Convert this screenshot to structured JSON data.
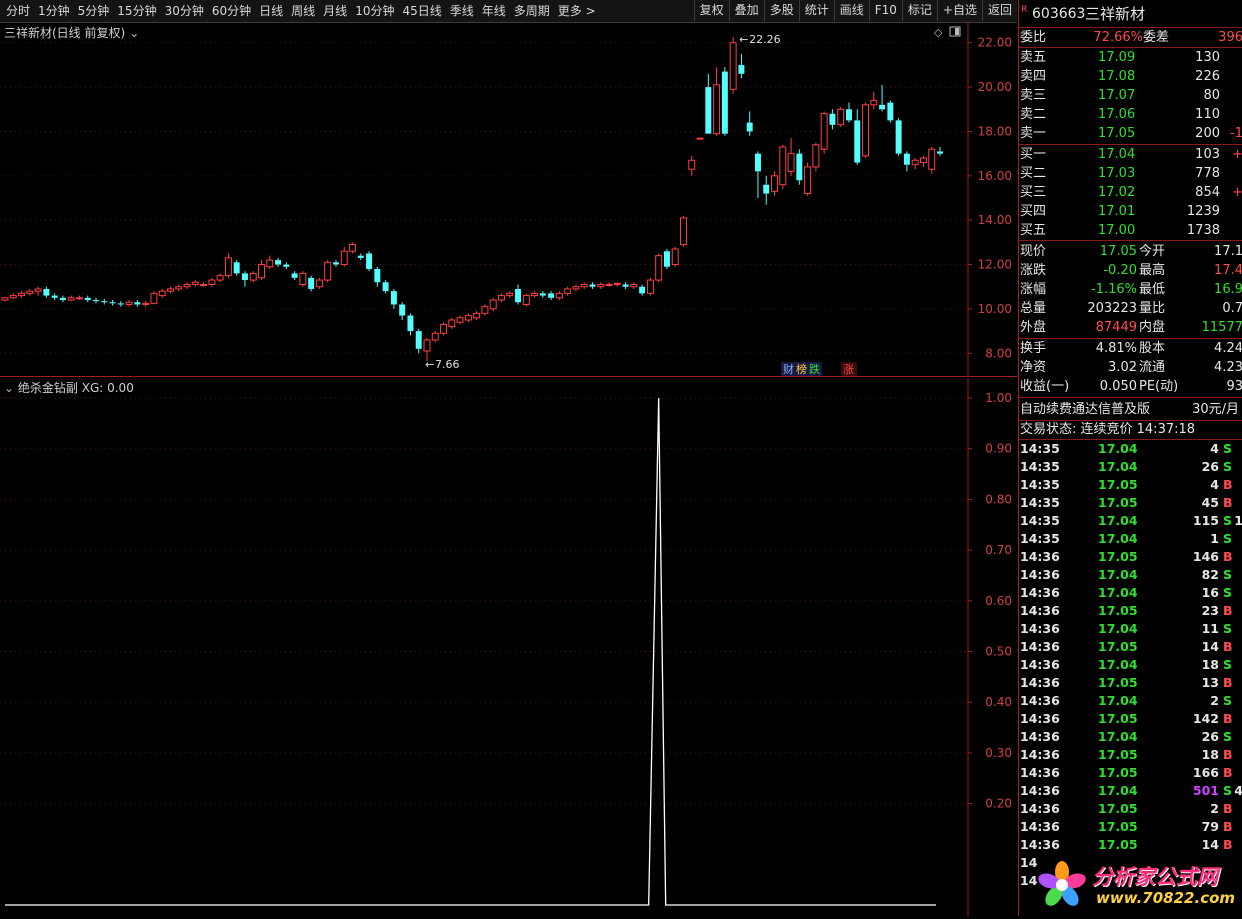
{
  "toolbar": {
    "periods": [
      "分时",
      "1分钟",
      "5分钟",
      "15分钟",
      "30分钟",
      "60分钟",
      "日线",
      "周线",
      "月线",
      "10分钟",
      "45日线",
      "季线",
      "年线",
      "多周期",
      "更多 >"
    ],
    "tools": [
      "复权",
      "叠加",
      "多股",
      "统计",
      "画线",
      "F10",
      "标记",
      "+自选",
      "返回"
    ]
  },
  "main_chart": {
    "title": "三祥新材(日线 前复权)",
    "high_label": "22.26",
    "low_label": "7.66",
    "badge_cai": "财",
    "badge_bang": "榜",
    "badge_die": "跌",
    "badge_zhang": "涨",
    "y_ticks": [
      "22.00",
      "20.00",
      "18.00",
      "16.00",
      "14.00",
      "12.00",
      "10.00",
      "8.00"
    ]
  },
  "indicator": {
    "title": "绝杀金钻副",
    "xg_label": "XG: 0.00",
    "y_ticks": [
      "1.00",
      "0.90",
      "0.80",
      "0.70",
      "0.60",
      "0.50",
      "0.40",
      "0.30",
      "0.20"
    ]
  },
  "chart_data": [
    {
      "type": "candlestick",
      "title": "三祥新材(日线 前复权)",
      "ylim": [
        7.2,
        22.8
      ],
      "grid": true,
      "up_color": "#ff4040",
      "down_color": "#54ffff",
      "candles": [
        [
          10.4,
          10.5,
          10.35,
          10.55
        ],
        [
          10.5,
          10.6,
          10.45,
          10.7
        ],
        [
          10.6,
          10.7,
          10.5,
          10.8
        ],
        [
          10.7,
          10.8,
          10.6,
          10.9
        ],
        [
          10.8,
          10.9,
          10.6,
          11.0
        ],
        [
          10.9,
          10.6,
          10.5,
          11.0
        ],
        [
          10.6,
          10.5,
          10.4,
          10.7
        ],
        [
          10.5,
          10.4,
          10.3,
          10.6
        ],
        [
          10.4,
          10.5,
          10.35,
          10.6
        ],
        [
          10.5,
          10.5,
          10.4,
          10.6
        ],
        [
          10.5,
          10.4,
          10.3,
          10.6
        ],
        [
          10.4,
          10.35,
          10.25,
          10.5
        ],
        [
          10.35,
          10.3,
          10.2,
          10.45
        ],
        [
          10.3,
          10.25,
          10.15,
          10.4
        ],
        [
          10.25,
          10.2,
          10.1,
          10.35
        ],
        [
          10.2,
          10.3,
          10.1,
          10.4
        ],
        [
          10.3,
          10.2,
          10.1,
          10.4
        ],
        [
          10.2,
          10.25,
          10.1,
          10.35
        ],
        [
          10.25,
          10.7,
          10.2,
          10.8
        ],
        [
          10.6,
          10.8,
          10.5,
          10.9
        ],
        [
          10.8,
          10.9,
          10.7,
          11.0
        ],
        [
          10.9,
          11.0,
          10.8,
          11.1
        ],
        [
          11.0,
          11.1,
          10.9,
          11.2
        ],
        [
          11.1,
          11.2,
          11.0,
          11.3
        ],
        [
          11.1,
          11.1,
          11.0,
          11.2
        ],
        [
          11.1,
          11.3,
          11.0,
          11.4
        ],
        [
          11.3,
          11.5,
          11.2,
          11.6
        ],
        [
          11.5,
          12.3,
          11.4,
          12.5
        ],
        [
          12.1,
          11.6,
          11.5,
          12.2
        ],
        [
          11.6,
          11.3,
          11.0,
          11.7
        ],
        [
          11.3,
          11.6,
          11.2,
          11.7
        ],
        [
          11.4,
          12.0,
          11.3,
          12.2
        ],
        [
          11.9,
          12.2,
          11.8,
          12.4
        ],
        [
          12.2,
          12.0,
          11.9,
          12.3
        ],
        [
          12.0,
          11.9,
          11.8,
          12.1
        ],
        [
          11.6,
          11.4,
          11.3,
          11.7
        ],
        [
          11.1,
          11.6,
          11.0,
          11.7
        ],
        [
          11.4,
          10.9,
          10.8,
          11.5
        ],
        [
          11.0,
          11.3,
          10.9,
          11.4
        ],
        [
          11.3,
          12.1,
          11.2,
          12.2
        ],
        [
          12.1,
          12.0,
          11.9,
          12.2
        ],
        [
          12.0,
          12.6,
          11.9,
          12.8
        ],
        [
          12.6,
          12.9,
          12.5,
          13.0
        ],
        [
          12.4,
          12.3,
          12.2,
          12.5
        ],
        [
          12.5,
          11.8,
          11.7,
          12.6
        ],
        [
          11.8,
          11.2,
          11.0,
          11.9
        ],
        [
          11.2,
          10.8,
          10.7,
          11.3
        ],
        [
          10.8,
          10.2,
          10.0,
          10.9
        ],
        [
          10.2,
          9.7,
          9.5,
          10.3
        ],
        [
          9.7,
          9.0,
          8.8,
          9.8
        ],
        [
          9.0,
          8.2,
          8.0,
          9.1
        ],
        [
          8.1,
          8.6,
          7.66,
          8.7
        ],
        [
          8.6,
          8.9,
          8.5,
          9.0
        ],
        [
          8.9,
          9.3,
          8.8,
          9.4
        ],
        [
          9.2,
          9.5,
          9.1,
          9.6
        ],
        [
          9.4,
          9.6,
          9.3,
          9.7
        ],
        [
          9.5,
          9.7,
          9.4,
          9.8
        ],
        [
          9.6,
          9.8,
          9.5,
          9.9
        ],
        [
          9.8,
          10.1,
          9.7,
          10.2
        ],
        [
          10.0,
          10.4,
          9.9,
          10.5
        ],
        [
          10.4,
          10.6,
          10.3,
          10.7
        ],
        [
          10.6,
          10.7,
          10.5,
          10.8
        ],
        [
          10.9,
          10.3,
          10.2,
          11.1
        ],
        [
          10.2,
          10.6,
          10.1,
          10.7
        ],
        [
          10.6,
          10.7,
          10.5,
          10.8
        ],
        [
          10.7,
          10.6,
          10.5,
          10.8
        ],
        [
          10.7,
          10.5,
          10.4,
          10.8
        ],
        [
          10.5,
          10.7,
          10.4,
          10.8
        ],
        [
          10.7,
          10.9,
          10.6,
          11.0
        ],
        [
          10.9,
          11.0,
          10.8,
          11.1
        ],
        [
          11.0,
          11.1,
          10.9,
          11.2
        ],
        [
          11.1,
          11.0,
          10.9,
          11.2
        ],
        [
          11.0,
          11.1,
          10.9,
          11.2
        ],
        [
          11.1,
          11.1,
          11.0,
          11.2
        ],
        [
          11.1,
          11.15,
          11.0,
          11.2
        ],
        [
          11.1,
          11.0,
          10.9,
          11.2
        ],
        [
          11.0,
          11.1,
          10.9,
          11.2
        ],
        [
          11.0,
          10.7,
          10.6,
          11.1
        ],
        [
          10.7,
          11.3,
          10.6,
          11.4
        ],
        [
          11.3,
          12.4,
          11.2,
          12.5
        ],
        [
          12.6,
          11.9,
          11.8,
          12.7
        ],
        [
          12.0,
          12.7,
          11.9,
          12.8
        ],
        [
          12.9,
          14.1,
          12.8,
          14.2
        ],
        [
          16.3,
          16.7,
          16.0,
          16.9
        ],
        [
          17.7,
          17.7,
          17.7,
          17.7
        ],
        [
          20.0,
          17.9,
          17.9,
          20.6
        ],
        [
          17.9,
          20.1,
          17.8,
          20.9
        ],
        [
          20.7,
          17.9,
          17.8,
          20.9
        ],
        [
          19.9,
          22.0,
          19.7,
          22.26
        ],
        [
          21.0,
          20.6,
          20.4,
          21.5
        ],
        [
          18.4,
          18.0,
          17.8,
          18.9
        ],
        [
          17.0,
          16.2,
          15.0,
          17.1
        ],
        [
          15.6,
          15.2,
          14.7,
          16.0
        ],
        [
          15.3,
          16.0,
          15.1,
          16.2
        ],
        [
          15.6,
          17.3,
          15.4,
          17.4
        ],
        [
          16.2,
          17.0,
          16.0,
          17.7
        ],
        [
          17.0,
          15.8,
          15.6,
          17.2
        ],
        [
          15.2,
          16.4,
          15.1,
          16.6
        ],
        [
          16.4,
          17.4,
          16.2,
          17.5
        ],
        [
          17.2,
          18.8,
          17.0,
          18.9
        ],
        [
          18.8,
          18.3,
          18.1,
          19.0
        ],
        [
          18.3,
          19.0,
          18.2,
          19.1
        ],
        [
          19.0,
          18.5,
          18.4,
          19.3
        ],
        [
          18.5,
          16.6,
          16.5,
          19.0
        ],
        [
          16.9,
          19.2,
          16.8,
          19.3
        ],
        [
          19.2,
          19.4,
          19.0,
          19.8
        ],
        [
          19.2,
          19.0,
          18.9,
          20.1
        ],
        [
          19.3,
          18.5,
          18.4,
          19.4
        ],
        [
          18.5,
          17.0,
          16.9,
          18.6
        ],
        [
          17.0,
          16.5,
          16.2,
          17.1
        ],
        [
          16.5,
          16.7,
          16.3,
          16.8
        ],
        [
          16.6,
          16.8,
          16.4,
          16.9
        ],
        [
          16.3,
          17.2,
          16.1,
          17.3
        ],
        [
          17.1,
          17.0,
          16.9,
          17.3
        ]
      ]
    },
    {
      "type": "line",
      "title": "绝杀金钻副",
      "ylim": [
        0,
        1.0
      ],
      "series": [
        {
          "name": "XG",
          "spike_index": 79,
          "spike_value": 1.0,
          "baseline": 0
        }
      ]
    }
  ],
  "quote": {
    "badge": "R",
    "code": "603663",
    "name": "三祥新材",
    "weibi_label": "委比",
    "weibi": "72.66%",
    "weicha_label": "委差",
    "weicha": "396",
    "asks": [
      {
        "label": "卖五",
        "price": "17.09",
        "vol": "130",
        "extra": ""
      },
      {
        "label": "卖四",
        "price": "17.08",
        "vol": "226",
        "extra": ""
      },
      {
        "label": "卖三",
        "price": "17.07",
        "vol": "80",
        "extra": ""
      },
      {
        "label": "卖二",
        "price": "17.06",
        "vol": "110",
        "extra": ""
      },
      {
        "label": "卖一",
        "price": "17.05",
        "vol": "200",
        "extra": "-1"
      }
    ],
    "bids": [
      {
        "label": "买一",
        "price": "17.04",
        "vol": "103",
        "extra": "+"
      },
      {
        "label": "买二",
        "price": "17.03",
        "vol": "778",
        "extra": ""
      },
      {
        "label": "买三",
        "price": "17.02",
        "vol": "854",
        "extra": "+"
      },
      {
        "label": "买四",
        "price": "17.01",
        "vol": "1239",
        "extra": ""
      },
      {
        "label": "买五",
        "price": "17.00",
        "vol": "1738",
        "extra": ""
      }
    ],
    "stats": [
      {
        "l1": "现价",
        "v1": "17.05",
        "l2": "今开",
        "v2": "17.1"
      },
      {
        "l1": "涨跌",
        "v1": "-0.20",
        "l2": "最高",
        "v2": "17.4"
      },
      {
        "l1": "涨幅",
        "v1": "-1.16%",
        "l2": "最低",
        "v2": "16.9"
      },
      {
        "l1": "总量",
        "v1": "203223",
        "l2": "量比",
        "v2": "0.7"
      },
      {
        "l1": "外盘",
        "v1": "87449",
        "l2": "内盘",
        "v2": "11577"
      }
    ],
    "stats2": [
      {
        "l1": "换手",
        "v1": "4.81%",
        "l2": "股本",
        "v2": "4.24"
      },
      {
        "l1": "净资",
        "v1": "3.02",
        "l2": "流通",
        "v2": "4.23"
      },
      {
        "l1": "收益(一)",
        "v1": "0.050",
        "l2": "PE(动)",
        "v2": "93"
      }
    ],
    "ad_text": "自动续费通达信普及版",
    "ad_price": "30元/月",
    "status_text": "交易状态: 连续竞价 14:37:18"
  },
  "ticks": [
    {
      "t": "14:35",
      "p": "17.04",
      "v": "4",
      "d": "S",
      "x": ""
    },
    {
      "t": "14:35",
      "p": "17.04",
      "v": "26",
      "d": "S",
      "x": ""
    },
    {
      "t": "14:35",
      "p": "17.05",
      "v": "4",
      "d": "B",
      "x": ""
    },
    {
      "t": "14:35",
      "p": "17.05",
      "v": "45",
      "d": "B",
      "x": ""
    },
    {
      "t": "14:35",
      "p": "17.04",
      "v": "115",
      "d": "S",
      "x": "1"
    },
    {
      "t": "14:35",
      "p": "17.04",
      "v": "1",
      "d": "S",
      "x": ""
    },
    {
      "t": "14:36",
      "p": "17.05",
      "v": "146",
      "d": "B",
      "x": ""
    },
    {
      "t": "14:36",
      "p": "17.04",
      "v": "82",
      "d": "S",
      "x": ""
    },
    {
      "t": "14:36",
      "p": "17.04",
      "v": "16",
      "d": "S",
      "x": ""
    },
    {
      "t": "14:36",
      "p": "17.05",
      "v": "23",
      "d": "B",
      "x": ""
    },
    {
      "t": "14:36",
      "p": "17.04",
      "v": "11",
      "d": "S",
      "x": ""
    },
    {
      "t": "14:36",
      "p": "17.05",
      "v": "14",
      "d": "B",
      "x": ""
    },
    {
      "t": "14:36",
      "p": "17.04",
      "v": "18",
      "d": "S",
      "x": ""
    },
    {
      "t": "14:36",
      "p": "17.05",
      "v": "13",
      "d": "B",
      "x": ""
    },
    {
      "t": "14:36",
      "p": "17.04",
      "v": "2",
      "d": "S",
      "x": ""
    },
    {
      "t": "14:36",
      "p": "17.05",
      "v": "142",
      "d": "B",
      "x": ""
    },
    {
      "t": "14:36",
      "p": "17.04",
      "v": "26",
      "d": "S",
      "x": ""
    },
    {
      "t": "14:36",
      "p": "17.05",
      "v": "18",
      "d": "B",
      "x": ""
    },
    {
      "t": "14:36",
      "p": "17.05",
      "v": "166",
      "d": "B",
      "x": ""
    },
    {
      "t": "14:36",
      "p": "17.04",
      "v": "501",
      "d": "S",
      "x": "4"
    },
    {
      "t": "14:36",
      "p": "17.05",
      "v": "2",
      "d": "B",
      "x": ""
    },
    {
      "t": "14:36",
      "p": "17.05",
      "v": "79",
      "d": "B",
      "x": ""
    },
    {
      "t": "14:36",
      "p": "17.05",
      "v": "14",
      "d": "B",
      "x": ""
    },
    {
      "t": "14",
      "p": "",
      "v": "",
      "d": "",
      "x": ""
    },
    {
      "t": "14",
      "p": "",
      "v": "",
      "d": "",
      "x": ""
    }
  ],
  "watermark": {
    "site_name": "分析家公式网",
    "url": "www.70822.com"
  },
  "colors": {
    "up": "#ff4040",
    "down": "#54ffff",
    "grid": "#8a1a1a",
    "bg": "#000000",
    "buy": "#ff4b4b",
    "sell": "#2ee02e"
  }
}
